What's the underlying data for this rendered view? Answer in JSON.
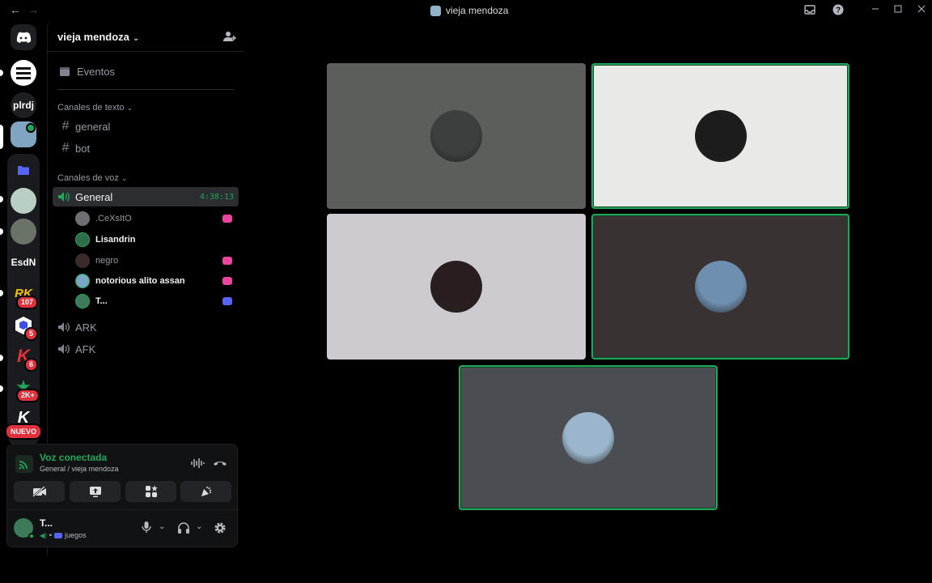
{
  "window": {
    "title": "vieja mendoza",
    "back": "←",
    "forward": "→"
  },
  "rail": {
    "text_servers": [
      "plrdj",
      "EsdN"
    ],
    "badges": [
      "107",
      "5",
      "6",
      "2K+"
    ],
    "nuevo_label": "NUEVO"
  },
  "server": {
    "name": "vieja mendoza",
    "events_label": "Eventos",
    "text_category": "Canales de texto",
    "voice_category": "Canales de voz",
    "text_channels": [
      "general",
      "bot"
    ],
    "voice_channels": [
      {
        "name": "General",
        "timer": "4:38:13"
      },
      {
        "name": "ARK"
      },
      {
        "name": "AFK"
      }
    ],
    "members": [
      {
        "name": ".CeXsItO",
        "bold": false,
        "activity_color": "#eb459e",
        "avatar_color": "#6d6f73"
      },
      {
        "name": "Lisandrin",
        "bold": true,
        "activity_color": "",
        "avatar_color": "#2e6b4a"
      },
      {
        "name": "negro",
        "bold": false,
        "activity_color": "#eb459e",
        "avatar_color": "#3a2b2b"
      },
      {
        "name": "notorious alito assan",
        "bold": true,
        "activity_color": "#eb459e",
        "avatar_color": "#7aa7c4"
      },
      {
        "name": "T...",
        "bold": true,
        "activity_color": "#5865f2",
        "avatar_color": "#3c7a5a"
      }
    ]
  },
  "voice_panel": {
    "title": "Voz conectada",
    "subtitle": "General / vieja mendoza"
  },
  "user": {
    "name": "T...",
    "status": "juegos"
  },
  "tiles": [
    {
      "bg": "#5c5e5b",
      "avatar": "#3d3f3e",
      "speaking": false
    },
    {
      "bg": "#e9e9e7",
      "avatar": "#1c1c1c",
      "speaking": true
    },
    {
      "bg": "#cdcbcf",
      "avatar": "#2a1d1f",
      "speaking": false
    },
    {
      "bg": "#393233",
      "avatar": "#6f8fb0",
      "speaking": true
    },
    {
      "bg": "#4a4d52",
      "avatar": "#9bb6cc",
      "speaking": true
    }
  ],
  "colors": {
    "accent_green": "#23a55a",
    "badge_red": "#e0323c",
    "nitro_pink": "#eb459e",
    "blurple": "#5865f2"
  }
}
